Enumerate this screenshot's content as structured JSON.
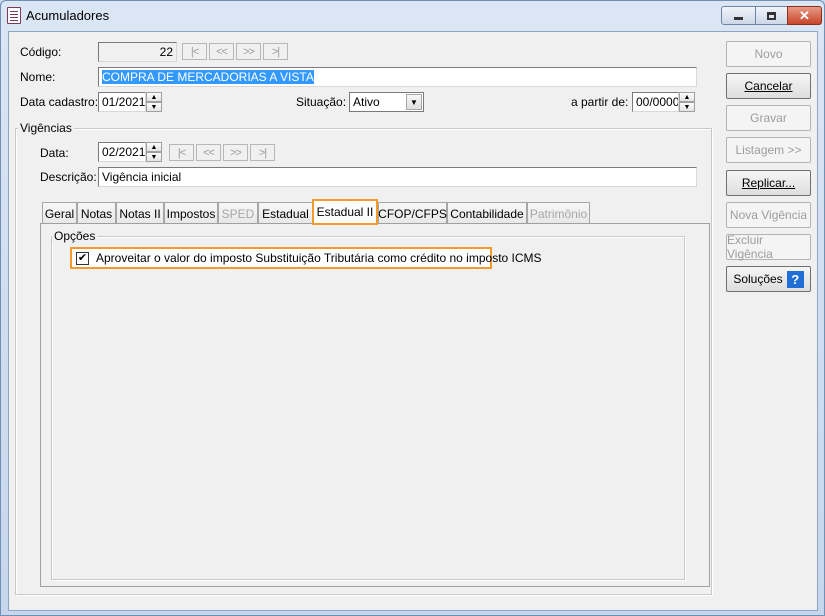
{
  "window": {
    "title": "Acumuladores"
  },
  "header": {
    "codigo_label": "Código:",
    "codigo_value": "22",
    "nav": [
      "|<",
      "<<",
      ">>",
      ">|"
    ],
    "nome_label": "Nome:",
    "nome_value": "COMPRA DE MERCADORIAS A VISTA",
    "data_cadastro_label": "Data cadastro:",
    "data_cadastro_value": "01/2021",
    "situacao_label": "Situação:",
    "situacao_value": "Ativo",
    "apartir_label": "a partir de:",
    "apartir_value": "00/0000"
  },
  "vigencias": {
    "title": "Vigências",
    "data_label": "Data:",
    "data_value": "02/2021",
    "nav": [
      "|<",
      "<<",
      ">>",
      ">|"
    ],
    "descricao_label": "Descrição:",
    "descricao_value": "Vigência inicial"
  },
  "tabs": [
    {
      "label": "Geral",
      "state": "normal"
    },
    {
      "label": "Notas",
      "state": "normal"
    },
    {
      "label": "Notas II",
      "state": "normal"
    },
    {
      "label": "Impostos",
      "state": "normal"
    },
    {
      "label": "SPED",
      "state": "disabled"
    },
    {
      "label": "Estadual",
      "state": "normal"
    },
    {
      "label": "Estadual II",
      "state": "active"
    },
    {
      "label": "CFOP/CFPS",
      "state": "normal"
    },
    {
      "label": "Contabilidade",
      "state": "normal"
    },
    {
      "label": "Patrimônio",
      "state": "disabled"
    }
  ],
  "opcoes": {
    "title": "Opções",
    "checkbox_label": "Aproveitar o valor do imposto Substituição Tributária como crédito no imposto ICMS",
    "checked": true
  },
  "buttons": [
    {
      "label": "Novo",
      "state": "disabled"
    },
    {
      "label": "Cancelar",
      "state": "normal"
    },
    {
      "label": "Gravar",
      "state": "disabled"
    },
    {
      "label": "Listagem >>",
      "state": "disabled"
    },
    {
      "label": "Replicar...",
      "state": "normal"
    },
    {
      "label": "Nova Vigência",
      "state": "disabled"
    },
    {
      "label": "Excluir Vigência",
      "state": "disabled"
    },
    {
      "label": "Soluções",
      "state": "normal"
    }
  ],
  "colors": {
    "highlight": "#f39a2a",
    "selection": "#3399ff",
    "help_icon": "#1f6fd6"
  }
}
